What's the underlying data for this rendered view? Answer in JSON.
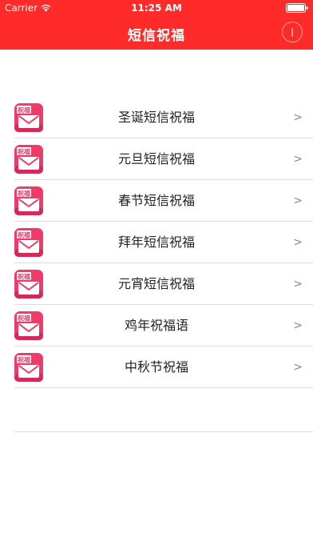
{
  "status_bar": {
    "carrier": "Carrier",
    "time": "11:25 AM",
    "wifi_icon": "wifi-icon",
    "battery_icon": "battery-icon"
  },
  "nav": {
    "title": "短信祝福",
    "info_icon": "info-icon"
  },
  "icon": {
    "text": "祝福",
    "envelope": "envelope-icon",
    "color": "#f03a6a"
  },
  "items": [
    {
      "label": "圣诞短信祝福",
      "chevron": ">"
    },
    {
      "label": "元旦短信祝福",
      "chevron": ">"
    },
    {
      "label": "春节短信祝福",
      "chevron": ">"
    },
    {
      "label": "拜年短信祝福",
      "chevron": ">"
    },
    {
      "label": "元宵短信祝福",
      "chevron": ">"
    },
    {
      "label": "鸡年祝福语",
      "chevron": ">"
    },
    {
      "label": "中秋节祝福",
      "chevron": ">"
    }
  ],
  "colors": {
    "nav_background": "#ff2a2a",
    "icon_pink": "#f03a6a"
  }
}
